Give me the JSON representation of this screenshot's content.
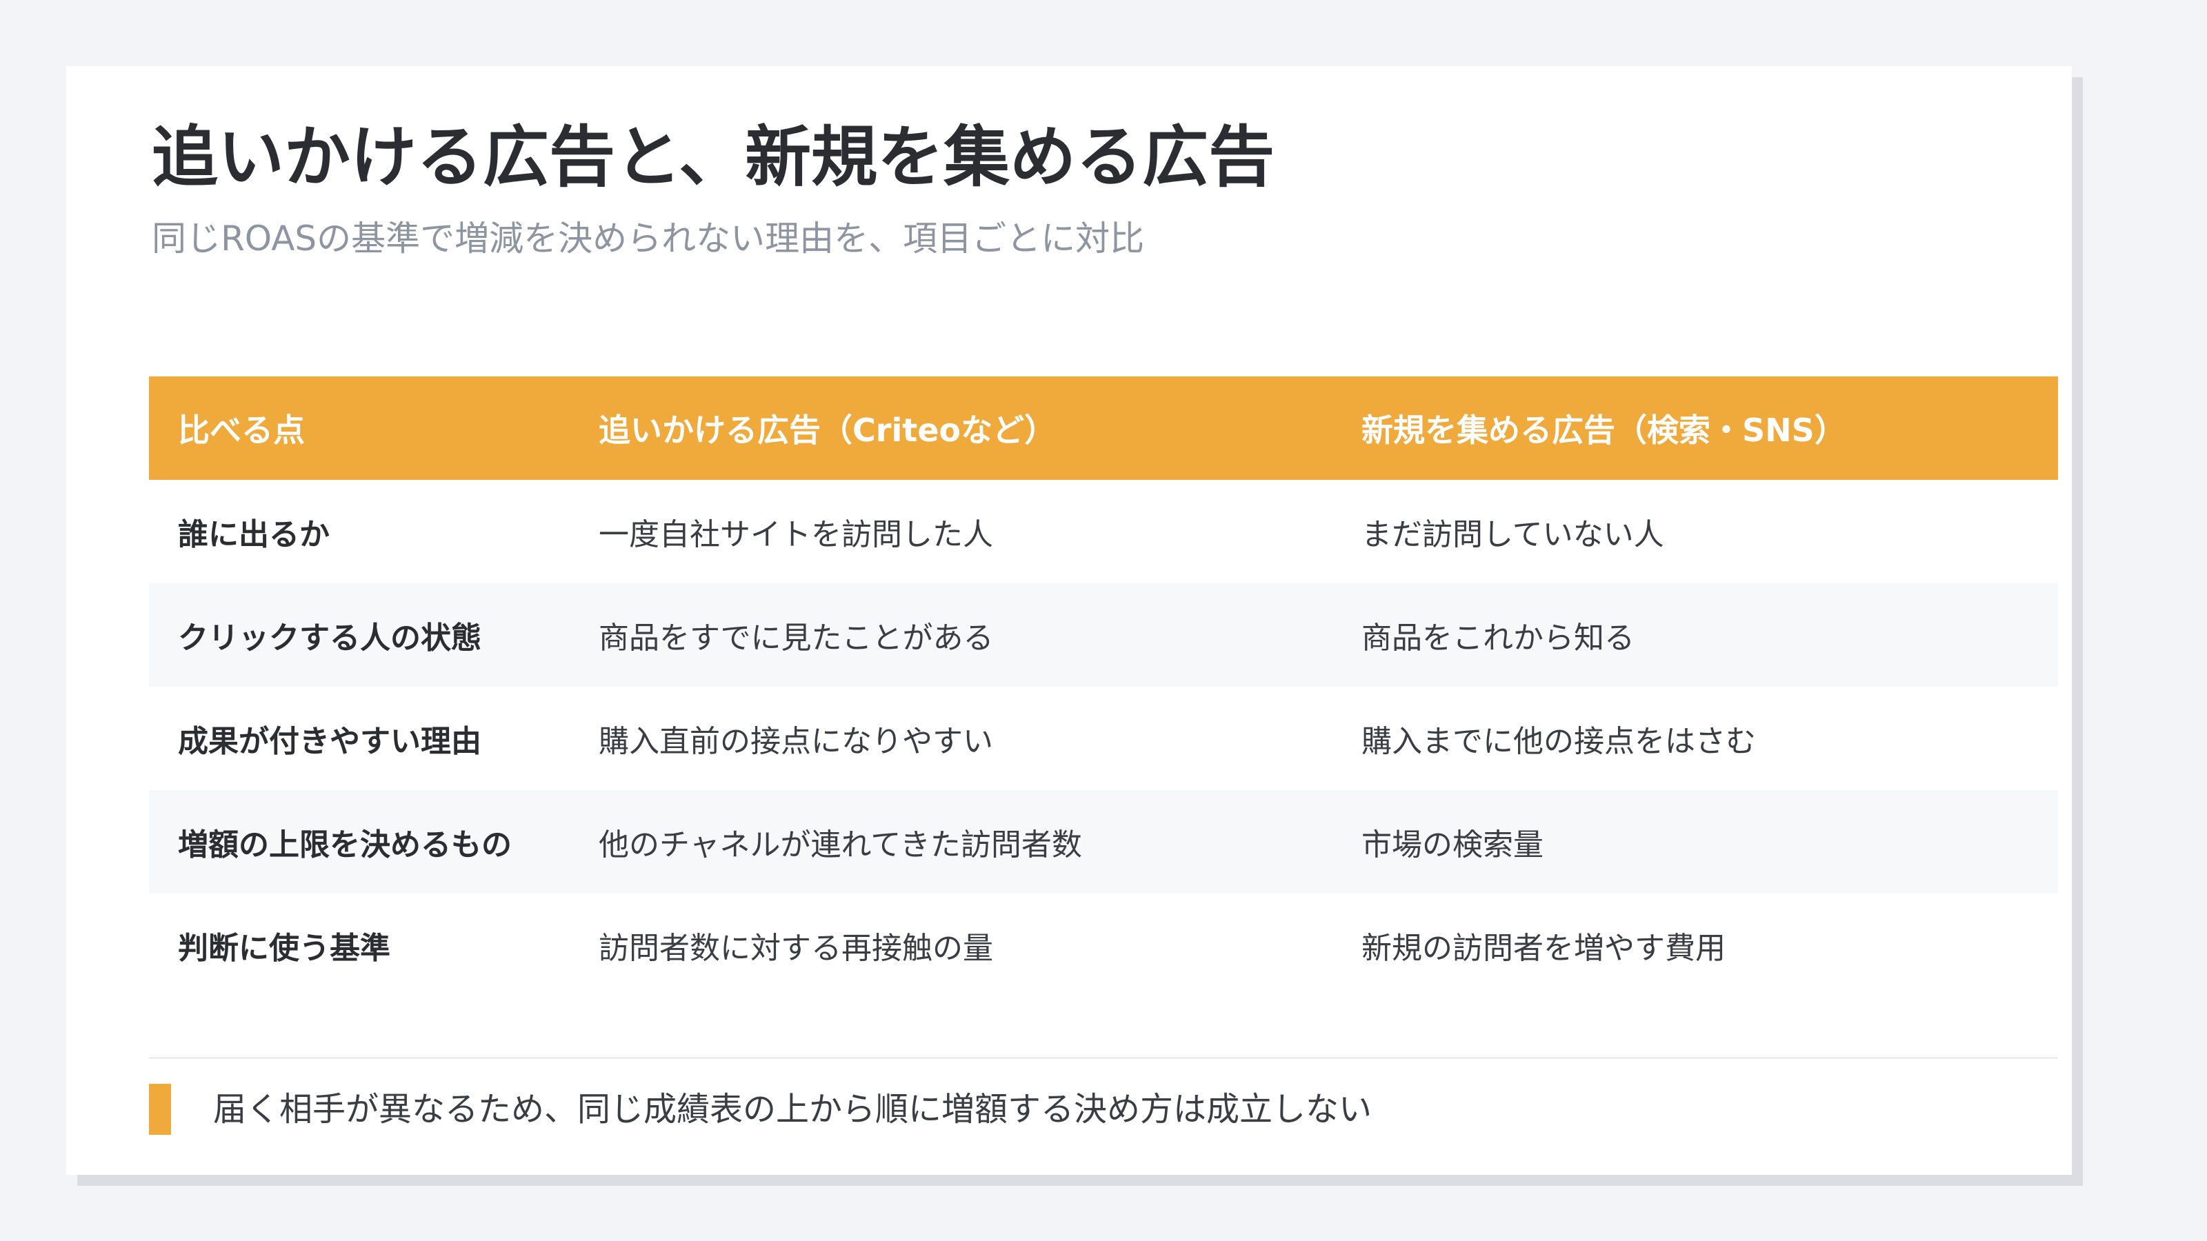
{
  "slide": {
    "title": "追いかける広告と、新規を集める広告",
    "subtitle": "同じROASの基準で増減を決められない理由を、項目ごとに対比"
  },
  "table": {
    "headers": [
      "比べる点",
      "追いかける広告（Criteoなど）",
      "新規を集める広告（検索・SNS）"
    ],
    "rows": [
      [
        "誰に出るか",
        "一度自社サイトを訪問した人",
        "まだ訪問していない人"
      ],
      [
        "クリックする人の状態",
        "商品をすでに見たことがある",
        "商品をこれから知る"
      ],
      [
        "成果が付きやすい理由",
        "購入直前の接点になりやすい",
        "購入までに他の接点をはさむ"
      ],
      [
        "増額の上限を決めるもの",
        "他のチャネルが連れてきた訪問者数",
        "市場の検索量"
      ],
      [
        "判断に使う基準",
        "訪問者数に対する再接触の量",
        "新規の訪問者を増やす費用"
      ]
    ]
  },
  "note": {
    "text": "届く相手が異なるため、同じ成績表の上から順に増額する決め方は成立しない"
  },
  "colors": {
    "accent": "#f0a93b",
    "title_text": "#2b2d33",
    "subtitle_text": "#8d95a3",
    "background": "#f3f4f8"
  }
}
